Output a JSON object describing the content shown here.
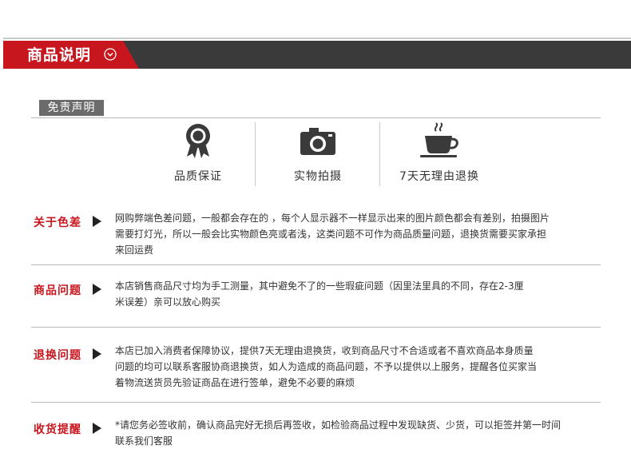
{
  "header": {
    "title": "商品说明"
  },
  "disclaimer": {
    "label": "免责声明"
  },
  "features": [
    {
      "label": "品质保证",
      "icon": "medal-icon"
    },
    {
      "label": "实物拍摄",
      "icon": "camera-icon"
    },
    {
      "label": "7天无理由退换",
      "icon": "coffee-cup-icon"
    }
  ],
  "sections": [
    {
      "title": "关于色差",
      "lines": [
        "网购弊端色差问题，一般都会存在的 ，每个人显示器不一样显示出来的图片颜色都会有差别，拍摄图片",
        "需要打灯光，所以一般会比实物颜色亮或者浅，这类问题不可作为商品质量问题，退换货需要买家承担",
        "来回运费"
      ]
    },
    {
      "title": "商品问题",
      "lines": [
        "本店销售商品尺寸均为手工测量，其中避免不了的一些瑕疵问题（因里法里具的不同，存在2-3厘",
        "米误差）亲可以放心购买"
      ]
    },
    {
      "title": "退换问题",
      "lines": [
        "本店已加入消费者保障协议，提供7天无理由退换货，收到商品尺寸不合适或者不喜欢商品本身质量",
        "问题的均可以联系客服协商退换货，如人为造成的商品问题，不予以提供以上服务，提醒各位买家当",
        "着物流送货员先验证商品在进行签单，避免不必要的麻烦"
      ]
    },
    {
      "title": "收货提醒",
      "lines": [
        "*请您务必签收前，确认商品完好无损后再签收，如检验商品过程中发现缺货、少货，可以拒签并第一时间",
        "联系我们客服"
      ]
    }
  ],
  "colors": {
    "accent": "#c8161e",
    "header_dark": "#3a3a3a",
    "tag_gray": "#6b6b6b"
  }
}
